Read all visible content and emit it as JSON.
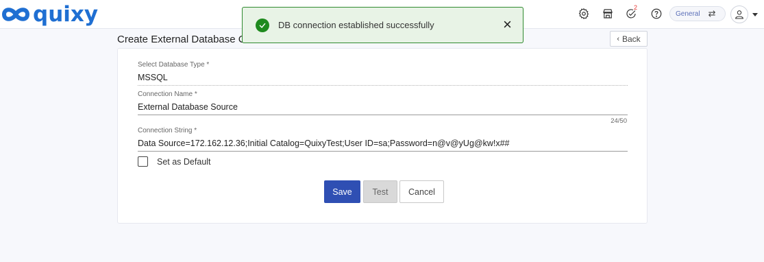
{
  "header": {
    "logo_text": "quixy",
    "icons": [
      "settings-icon",
      "store-icon",
      "tasks-icon",
      "help-icon"
    ],
    "tasks_badge": "2",
    "workspace": "General",
    "brand_color": "#1f6fd2"
  },
  "toast": {
    "message": "DB connection established successfully",
    "status": "success",
    "color": "#1e8a1e"
  },
  "page": {
    "title": "Create External Database C",
    "back_label": "Back"
  },
  "form": {
    "db_type": {
      "label": "Select Database Type *",
      "value": "MSSQL"
    },
    "connection_name": {
      "label": "Connection Name *",
      "value": "External Database Source",
      "counter": "24/50"
    },
    "connection_string": {
      "label": "Connection String *",
      "value": "Data Source=172.162.12.36;Initial Catalog=QuixyTest;User ID=sa;Password=n@v@yUg@kw!x##"
    },
    "default_checkbox": {
      "label": "Set as Default",
      "checked": false
    }
  },
  "actions": {
    "save": "Save",
    "test": "Test",
    "cancel": "Cancel",
    "primary_color": "#2f4fb3"
  }
}
